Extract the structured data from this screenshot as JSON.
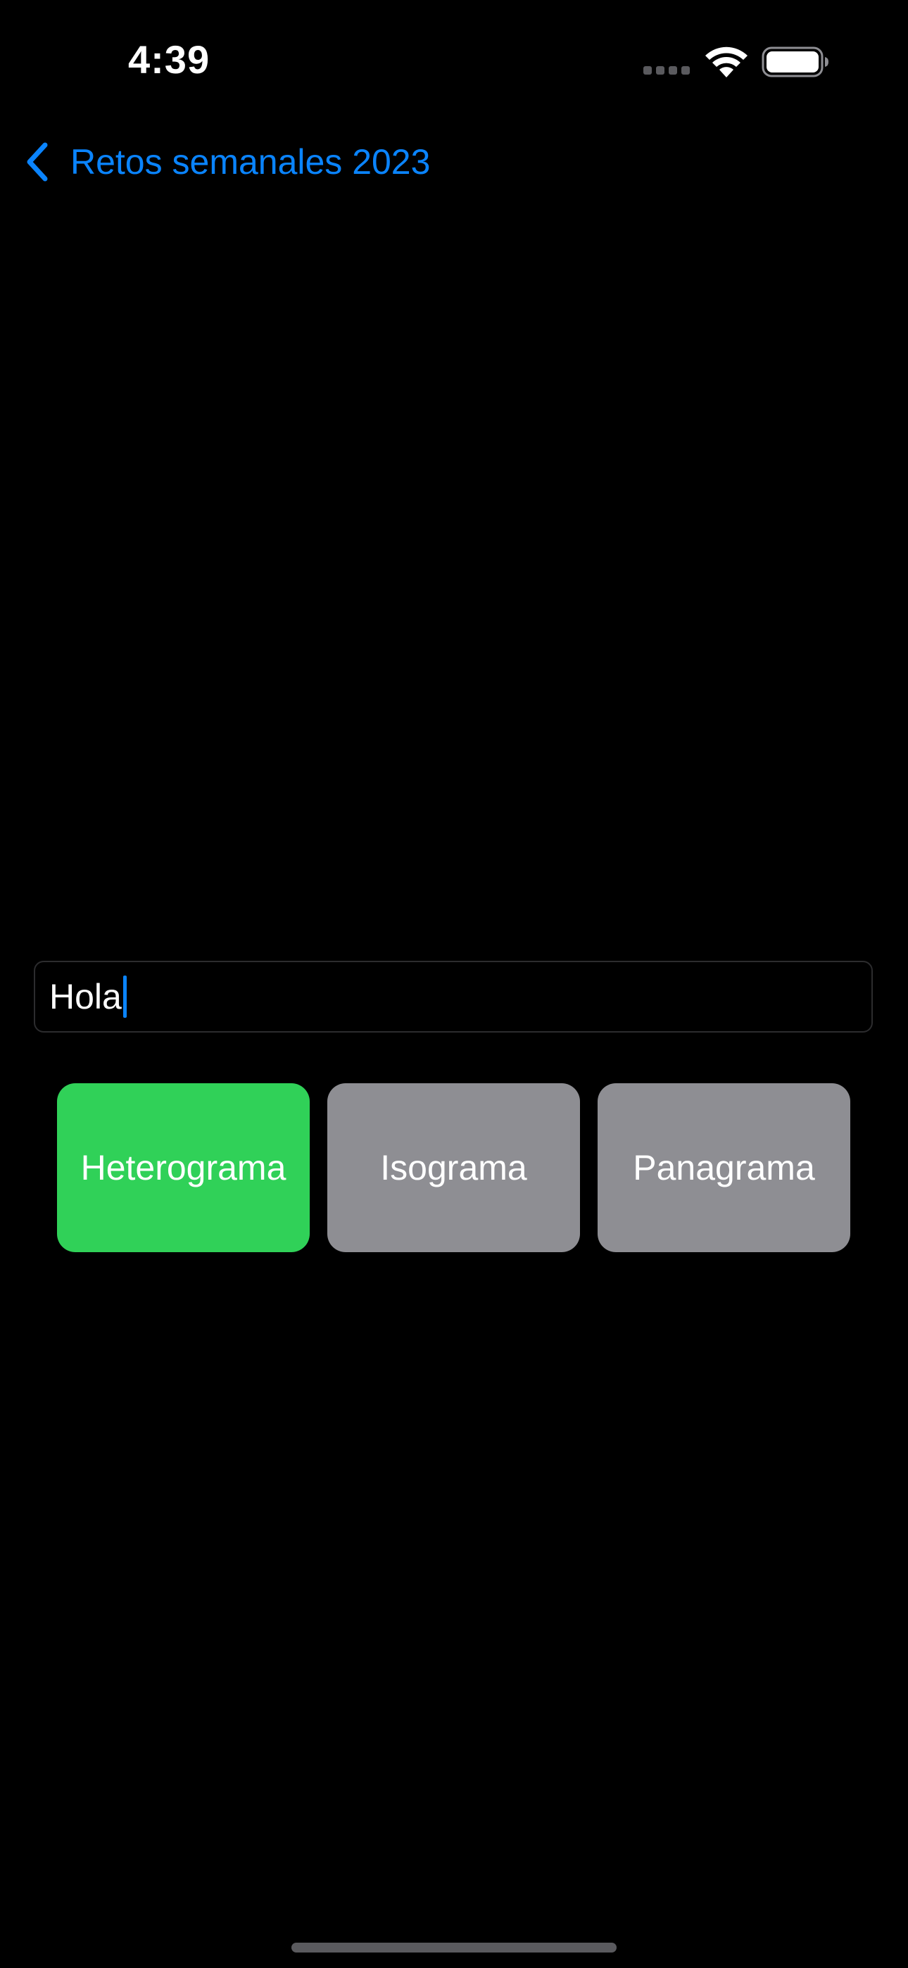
{
  "status_bar": {
    "time": "4:39",
    "icons": [
      "cellular-dots-icon",
      "wifi-icon",
      "battery-icon"
    ]
  },
  "navigation": {
    "back_label": "Retos semanales 2023",
    "back_icon": "chevron-left-icon"
  },
  "input": {
    "value": "Hola",
    "focused": true
  },
  "buttons": [
    {
      "label": "Heterograma",
      "color": "#30d158",
      "selected": true
    },
    {
      "label": "Isograma",
      "color": "#8e8e93",
      "selected": false
    },
    {
      "label": "Panagrama",
      "color": "#8e8e93",
      "selected": false
    }
  ],
  "colors": {
    "background": "#000000",
    "accent": "#0a84ff",
    "success": "#30d158",
    "neutral": "#8e8e93"
  }
}
